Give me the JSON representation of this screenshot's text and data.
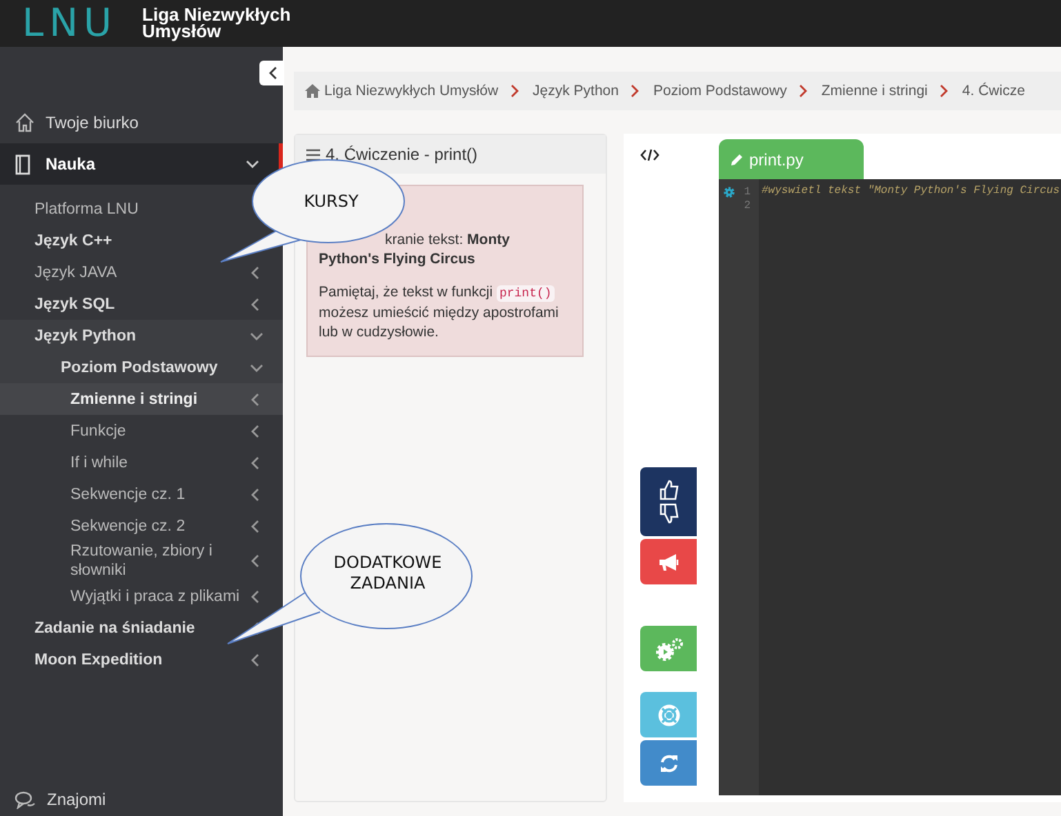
{
  "header": {
    "logo_text": "LNU",
    "brand": "Liga Niezwykłych Umysłów"
  },
  "sidebar": {
    "items": [
      {
        "label": "Twoje biurko",
        "kind": "home",
        "selected": false
      },
      {
        "label": "Nauka",
        "kind": "book",
        "selected": true,
        "expanded": true,
        "children": [
          {
            "label": "Platforma LNU",
            "bold": false,
            "selected": false
          },
          {
            "label": "Język C++",
            "bold": true,
            "selected": false
          },
          {
            "label": "Język JAVA",
            "bold": false,
            "selected": false,
            "expanded": false
          },
          {
            "label": "Język SQL",
            "bold": true,
            "selected": false,
            "expanded": false
          },
          {
            "label": "Język Python",
            "bold": true,
            "selected": false,
            "expanded": true,
            "children": [
              {
                "label": "Poziom Podstawowy",
                "bold": true,
                "selected": false,
                "expanded": true,
                "children": [
                  {
                    "label": "Zmienne i stringi",
                    "bold": true,
                    "selected": true,
                    "expanded": false
                  },
                  {
                    "label": "Funkcje",
                    "bold": false,
                    "selected": false,
                    "expanded": false
                  },
                  {
                    "label": "If i while",
                    "bold": false,
                    "selected": false,
                    "expanded": false
                  },
                  {
                    "label": "Sekwencje cz. 1",
                    "bold": false,
                    "selected": false,
                    "expanded": false
                  },
                  {
                    "label": "Sekwencje cz. 2",
                    "bold": false,
                    "selected": false,
                    "expanded": false
                  },
                  {
                    "label": "Rzutowanie, zbiory i słowniki",
                    "bold": false,
                    "selected": false,
                    "expanded": false
                  },
                  {
                    "label": "Wyjątki i praca z plikami",
                    "bold": false,
                    "selected": false,
                    "expanded": false
                  }
                ]
              }
            ]
          },
          {
            "label": "Zadanie na śniadanie",
            "bold": true,
            "selected": false,
            "expanded": false
          },
          {
            "label": "Moon Expedition",
            "bold": true,
            "selected": false,
            "expanded": false
          }
        ]
      }
    ],
    "footer_items": [
      {
        "label": "Znajomi",
        "kind": "chat"
      }
    ]
  },
  "breadcrumb": [
    "Liga Niezwykłych Umysłów",
    "Język Python",
    "Poziom Podstawowy",
    "Zmienne i stringi",
    "4. Ćwicze"
  ],
  "exercise": {
    "title": "4. Ćwiczenie - print()",
    "task": "kranie tekst: **Monty Python's Flying Circus**",
    "note": [
      {
        "kind": "text",
        "text": "Pamiętaj, że tekst w funkcji "
      },
      {
        "kind": "code",
        "text": "print()"
      },
      {
        "kind": "text",
        "text": " możesz umieścić między apostrofami lub w cudzysłowie."
      }
    ]
  },
  "action_buttons": [
    {
      "kind": "vote"
    },
    {
      "kind": "report"
    },
    {
      "kind": "run"
    },
    {
      "kind": "help"
    },
    {
      "kind": "reset"
    }
  ],
  "editor": {
    "filename": "print.py",
    "lines": [
      {
        "number": "1",
        "code": "#wyswietl tekst \"Monty Python's Flying Circus"
      },
      {
        "number": "2"
      }
    ]
  },
  "callouts": [
    {
      "text": "KURSY"
    },
    {
      "text": "DODATKOWE ZADANIA"
    }
  ]
}
